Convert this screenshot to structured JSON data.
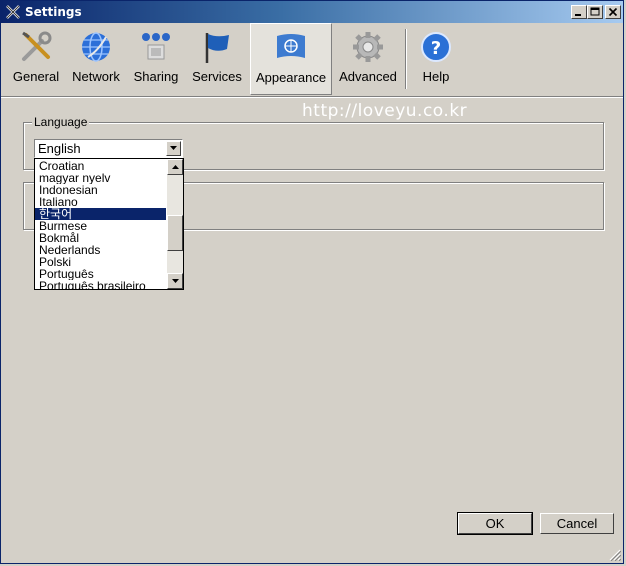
{
  "window": {
    "title": "Settings"
  },
  "toolbar": {
    "tabs": [
      {
        "label": "General",
        "icon": "tools-icon"
      },
      {
        "label": "Network",
        "icon": "network-globe-icon"
      },
      {
        "label": "Sharing",
        "icon": "sharing-icon"
      },
      {
        "label": "Services",
        "icon": "flag-icon"
      },
      {
        "label": "Appearance",
        "icon": "un-flag-icon",
        "active": true
      },
      {
        "label": "Advanced",
        "icon": "gear-icon"
      },
      {
        "label": "Help",
        "icon": "help-icon"
      }
    ]
  },
  "watermark": "http://loveyu.co.kr",
  "language_group": {
    "legend": "Language",
    "selected": "English",
    "options": [
      "Croatian",
      "magyar nyelv",
      "Indonesian",
      "Italiano",
      "한국어",
      "Burmese",
      "Bokmål",
      "Nederlands",
      "Polski",
      "Português",
      "Português brasileiro"
    ],
    "highlighted": "한국어"
  },
  "buttons": {
    "ok": "OK",
    "cancel": "Cancel"
  },
  "colors": {
    "selection": "#0a246a",
    "titlebar_start": "#0a246a",
    "titlebar_end": "#a6caf0",
    "face": "#d4d0c8"
  }
}
